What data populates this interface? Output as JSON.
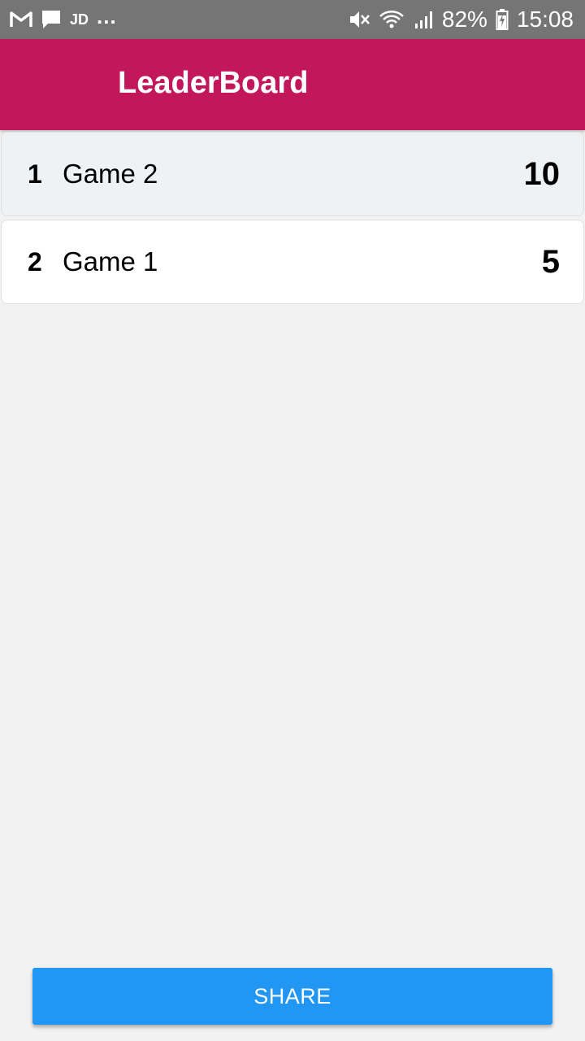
{
  "status_bar": {
    "notification_icons": [
      "gmail-icon",
      "message-icon"
    ],
    "jd_label": "JD",
    "more_label": "...",
    "status_icons": [
      "mute-icon",
      "wifi-icon",
      "signal-icon"
    ],
    "battery_percent": "82%",
    "battery_level": 0.82,
    "time": "15:08"
  },
  "app_bar": {
    "title": "LeaderBoard",
    "color": "#c2185b"
  },
  "leaderboard": {
    "rows": [
      {
        "rank": "1",
        "name": "Game 2",
        "score": "10"
      },
      {
        "rank": "2",
        "name": "Game 1",
        "score": "5"
      }
    ]
  },
  "share_button": {
    "label": "SHARE",
    "color": "#2196f3"
  }
}
